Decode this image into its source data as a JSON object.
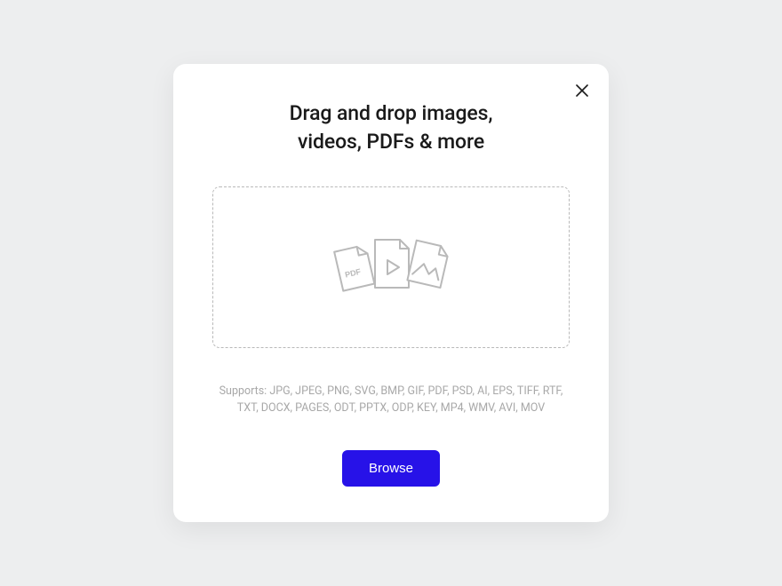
{
  "modal": {
    "title_line1": "Drag and drop images,",
    "title_line2": "videos, PDFs & more",
    "supports_text": "Supports: JPG, JPEG, PNG, SVG, BMP, GIF, PDF, PSD, AI, EPS, TIFF, RTF, TXT, DOCX, PAGES, ODT, PPTX, ODP, KEY, MP4, WMV, AVI, MOV",
    "browse_label": "Browse",
    "pdf_badge": "PDF"
  },
  "colors": {
    "primary": "#2712e8",
    "text": "#1a1a1a",
    "muted": "#a8a8a8",
    "border": "#b9b9b9",
    "background": "#edeeef"
  },
  "supported_formats": [
    "JPG",
    "JPEG",
    "PNG",
    "SVG",
    "BMP",
    "GIF",
    "PDF",
    "PSD",
    "AI",
    "EPS",
    "TIFF",
    "RTF",
    "TXT",
    "DOCX",
    "PAGES",
    "ODT",
    "PPTX",
    "ODP",
    "KEY",
    "MP4",
    "WMV",
    "AVI",
    "MOV"
  ]
}
